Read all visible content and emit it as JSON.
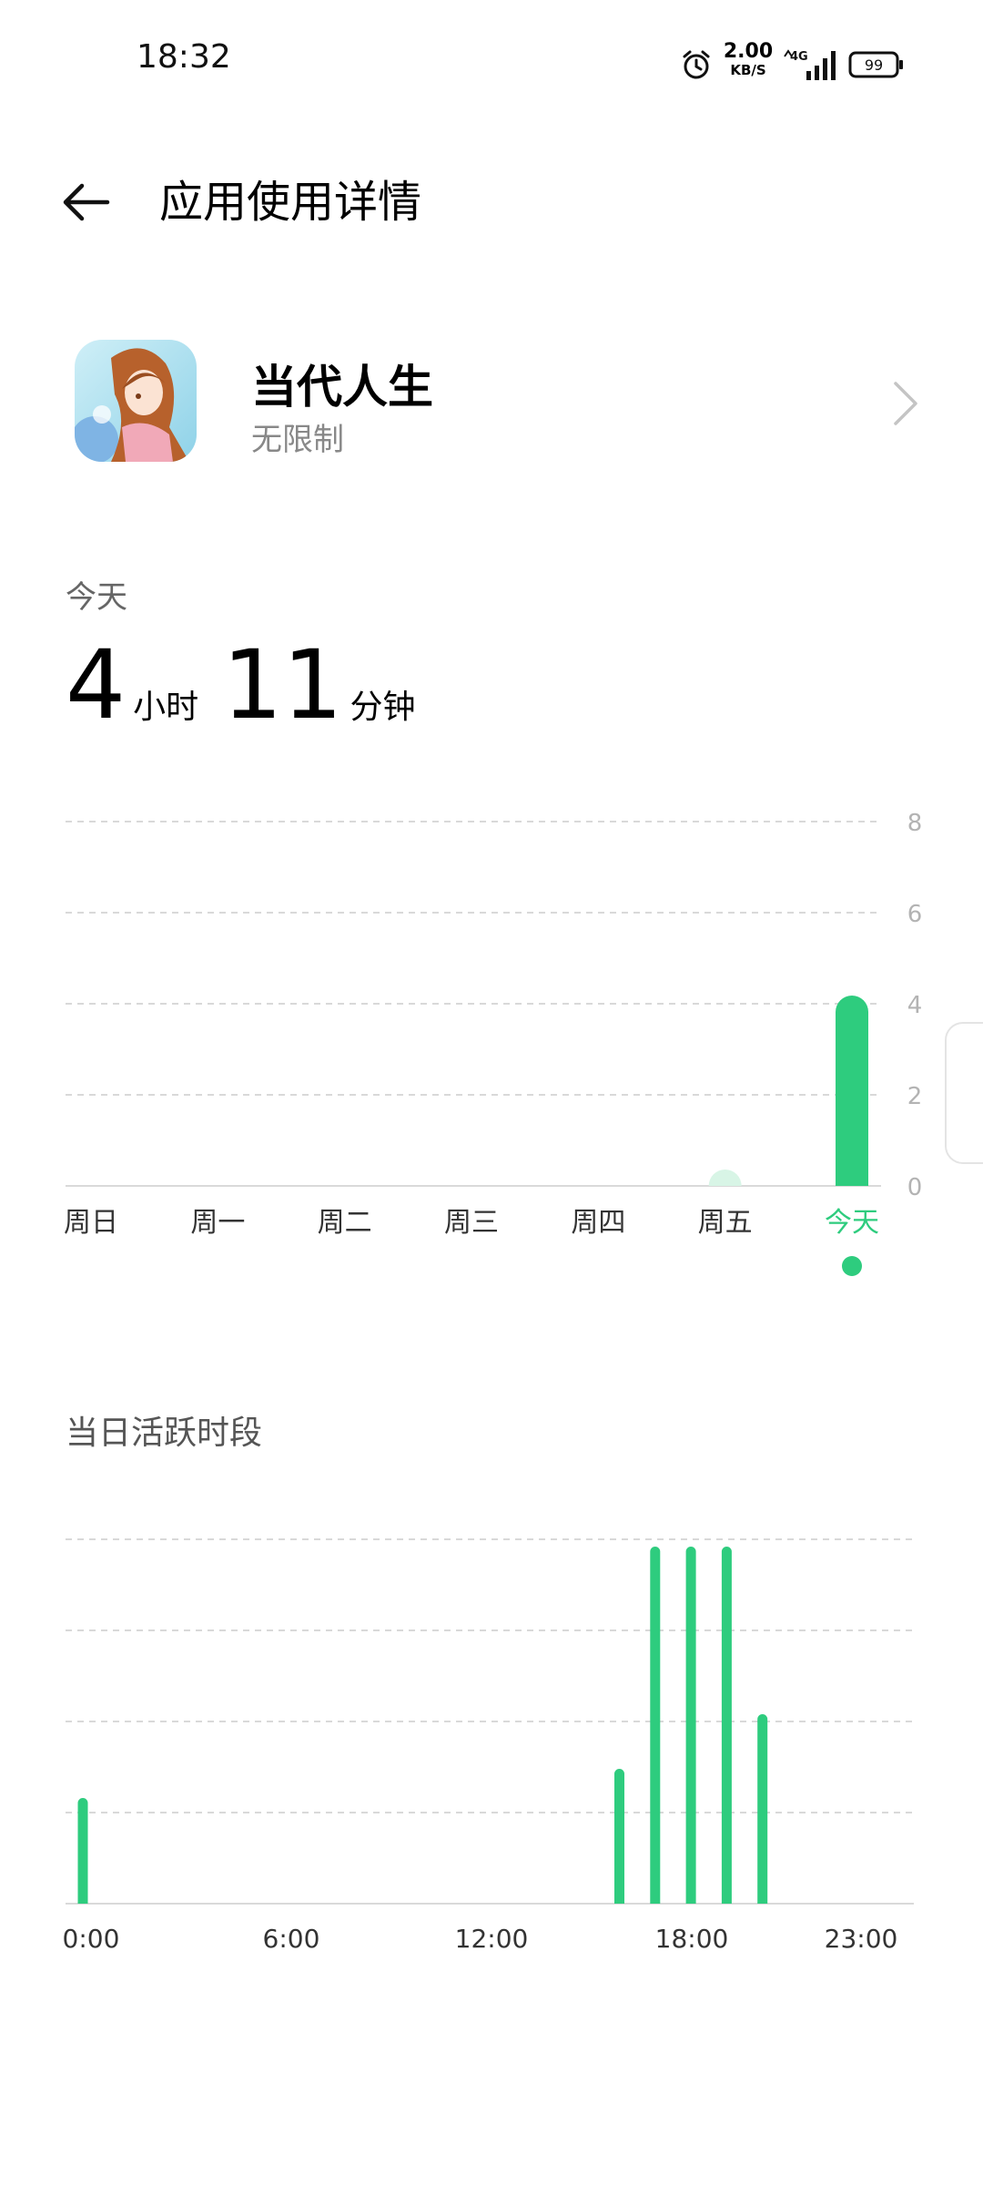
{
  "status_bar": {
    "time": "18:32",
    "net_speed_value": "2.00",
    "net_speed_unit": "KB/S",
    "network": "4G",
    "battery": "99",
    "icons": [
      "alarm-icon",
      "signal-icon",
      "battery-icon"
    ]
  },
  "header": {
    "title": "应用使用详情",
    "back_icon": "back-arrow-icon"
  },
  "app": {
    "name": "当代人生",
    "limit_status": "无限制"
  },
  "today": {
    "label": "今天",
    "hours": "4",
    "hours_unit": "小时",
    "minutes": "11",
    "minutes_unit": "分钟"
  },
  "colors": {
    "accent": "#2ecc7e",
    "accent_light": "#d8f5e6",
    "grid": "#d9d9d9",
    "axis_text": "#333333",
    "tick_text": "#b3b3b3"
  },
  "active_section": {
    "title": "当日活跃时段"
  },
  "chart_data": [
    {
      "type": "bar",
      "categories": [
        "周日",
        "周一",
        "周二",
        "周三",
        "周四",
        "周五",
        "今天"
      ],
      "values": [
        0,
        0,
        0,
        0,
        0,
        0.05,
        4.18
      ],
      "yticks": [
        "0",
        "2",
        "4",
        "6",
        "8"
      ],
      "ylim": [
        0,
        8
      ],
      "grid": true,
      "highlight": "今天"
    },
    {
      "type": "bar",
      "x": [
        0,
        15,
        16,
        17,
        18,
        19
      ],
      "values": [
        0.29,
        0.37,
        0.98,
        0.98,
        0.98,
        0.52
      ],
      "xticks": [
        "0:00",
        "6:00",
        "12:00",
        "18:00",
        "23:00"
      ],
      "xlim": [
        0,
        23
      ],
      "ylim": [
        0,
        1
      ],
      "grid": true
    }
  ]
}
